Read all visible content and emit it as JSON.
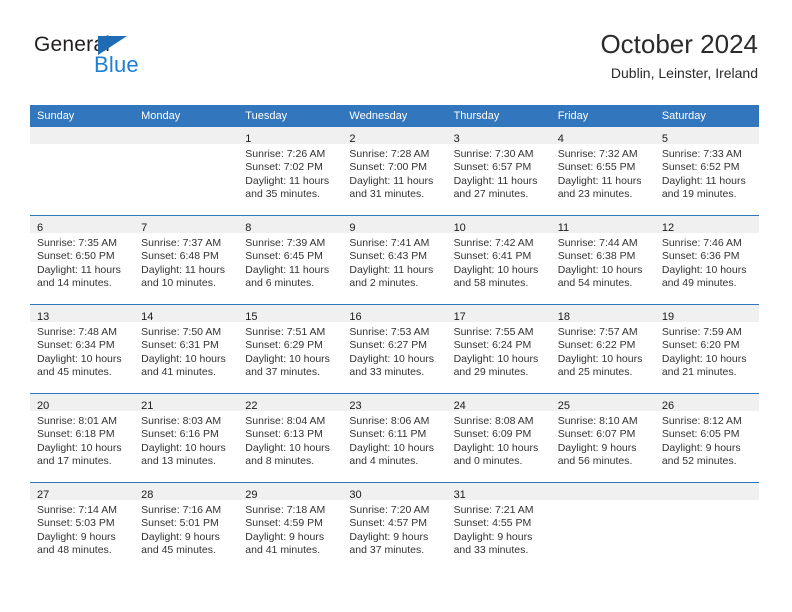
{
  "brand": {
    "name_dark": "General",
    "name_blue": "Blue",
    "accent_color": "#1f7fd4",
    "triangle_color": "#1f6cb4"
  },
  "header": {
    "month_title": "October 2024",
    "location": "Dublin, Leinster, Ireland"
  },
  "theme": {
    "header_row_bg": "#3276bd",
    "header_row_text": "#ffffff",
    "daynum_strip_bg": "#f0f0f0",
    "row_divider": "#3276bd"
  },
  "weekday_headers": [
    "Sunday",
    "Monday",
    "Tuesday",
    "Wednesday",
    "Thursday",
    "Friday",
    "Saturday"
  ],
  "labels": {
    "sunrise_prefix": "Sunrise:",
    "sunset_prefix": "Sunset:",
    "daylight_prefix": "Daylight:"
  },
  "weeks": [
    [
      {
        "empty": true
      },
      {
        "empty": true
      },
      {
        "day": "1",
        "sunrise": "Sunrise: 7:26 AM",
        "sunset": "Sunset: 7:02 PM",
        "daylight": "Daylight: 11 hours and 35 minutes."
      },
      {
        "day": "2",
        "sunrise": "Sunrise: 7:28 AM",
        "sunset": "Sunset: 7:00 PM",
        "daylight": "Daylight: 11 hours and 31 minutes."
      },
      {
        "day": "3",
        "sunrise": "Sunrise: 7:30 AM",
        "sunset": "Sunset: 6:57 PM",
        "daylight": "Daylight: 11 hours and 27 minutes."
      },
      {
        "day": "4",
        "sunrise": "Sunrise: 7:32 AM",
        "sunset": "Sunset: 6:55 PM",
        "daylight": "Daylight: 11 hours and 23 minutes."
      },
      {
        "day": "5",
        "sunrise": "Sunrise: 7:33 AM",
        "sunset": "Sunset: 6:52 PM",
        "daylight": "Daylight: 11 hours and 19 minutes."
      }
    ],
    [
      {
        "day": "6",
        "sunrise": "Sunrise: 7:35 AM",
        "sunset": "Sunset: 6:50 PM",
        "daylight": "Daylight: 11 hours and 14 minutes."
      },
      {
        "day": "7",
        "sunrise": "Sunrise: 7:37 AM",
        "sunset": "Sunset: 6:48 PM",
        "daylight": "Daylight: 11 hours and 10 minutes."
      },
      {
        "day": "8",
        "sunrise": "Sunrise: 7:39 AM",
        "sunset": "Sunset: 6:45 PM",
        "daylight": "Daylight: 11 hours and 6 minutes."
      },
      {
        "day": "9",
        "sunrise": "Sunrise: 7:41 AM",
        "sunset": "Sunset: 6:43 PM",
        "daylight": "Daylight: 11 hours and 2 minutes."
      },
      {
        "day": "10",
        "sunrise": "Sunrise: 7:42 AM",
        "sunset": "Sunset: 6:41 PM",
        "daylight": "Daylight: 10 hours and 58 minutes."
      },
      {
        "day": "11",
        "sunrise": "Sunrise: 7:44 AM",
        "sunset": "Sunset: 6:38 PM",
        "daylight": "Daylight: 10 hours and 54 minutes."
      },
      {
        "day": "12",
        "sunrise": "Sunrise: 7:46 AM",
        "sunset": "Sunset: 6:36 PM",
        "daylight": "Daylight: 10 hours and 49 minutes."
      }
    ],
    [
      {
        "day": "13",
        "sunrise": "Sunrise: 7:48 AM",
        "sunset": "Sunset: 6:34 PM",
        "daylight": "Daylight: 10 hours and 45 minutes."
      },
      {
        "day": "14",
        "sunrise": "Sunrise: 7:50 AM",
        "sunset": "Sunset: 6:31 PM",
        "daylight": "Daylight: 10 hours and 41 minutes."
      },
      {
        "day": "15",
        "sunrise": "Sunrise: 7:51 AM",
        "sunset": "Sunset: 6:29 PM",
        "daylight": "Daylight: 10 hours and 37 minutes."
      },
      {
        "day": "16",
        "sunrise": "Sunrise: 7:53 AM",
        "sunset": "Sunset: 6:27 PM",
        "daylight": "Daylight: 10 hours and 33 minutes."
      },
      {
        "day": "17",
        "sunrise": "Sunrise: 7:55 AM",
        "sunset": "Sunset: 6:24 PM",
        "daylight": "Daylight: 10 hours and 29 minutes."
      },
      {
        "day": "18",
        "sunrise": "Sunrise: 7:57 AM",
        "sunset": "Sunset: 6:22 PM",
        "daylight": "Daylight: 10 hours and 25 minutes."
      },
      {
        "day": "19",
        "sunrise": "Sunrise: 7:59 AM",
        "sunset": "Sunset: 6:20 PM",
        "daylight": "Daylight: 10 hours and 21 minutes."
      }
    ],
    [
      {
        "day": "20",
        "sunrise": "Sunrise: 8:01 AM",
        "sunset": "Sunset: 6:18 PM",
        "daylight": "Daylight: 10 hours and 17 minutes."
      },
      {
        "day": "21",
        "sunrise": "Sunrise: 8:03 AM",
        "sunset": "Sunset: 6:16 PM",
        "daylight": "Daylight: 10 hours and 13 minutes."
      },
      {
        "day": "22",
        "sunrise": "Sunrise: 8:04 AM",
        "sunset": "Sunset: 6:13 PM",
        "daylight": "Daylight: 10 hours and 8 minutes."
      },
      {
        "day": "23",
        "sunrise": "Sunrise: 8:06 AM",
        "sunset": "Sunset: 6:11 PM",
        "daylight": "Daylight: 10 hours and 4 minutes."
      },
      {
        "day": "24",
        "sunrise": "Sunrise: 8:08 AM",
        "sunset": "Sunset: 6:09 PM",
        "daylight": "Daylight: 10 hours and 0 minutes."
      },
      {
        "day": "25",
        "sunrise": "Sunrise: 8:10 AM",
        "sunset": "Sunset: 6:07 PM",
        "daylight": "Daylight: 9 hours and 56 minutes."
      },
      {
        "day": "26",
        "sunrise": "Sunrise: 8:12 AM",
        "sunset": "Sunset: 6:05 PM",
        "daylight": "Daylight: 9 hours and 52 minutes."
      }
    ],
    [
      {
        "day": "27",
        "sunrise": "Sunrise: 7:14 AM",
        "sunset": "Sunset: 5:03 PM",
        "daylight": "Daylight: 9 hours and 48 minutes."
      },
      {
        "day": "28",
        "sunrise": "Sunrise: 7:16 AM",
        "sunset": "Sunset: 5:01 PM",
        "daylight": "Daylight: 9 hours and 45 minutes."
      },
      {
        "day": "29",
        "sunrise": "Sunrise: 7:18 AM",
        "sunset": "Sunset: 4:59 PM",
        "daylight": "Daylight: 9 hours and 41 minutes."
      },
      {
        "day": "30",
        "sunrise": "Sunrise: 7:20 AM",
        "sunset": "Sunset: 4:57 PM",
        "daylight": "Daylight: 9 hours and 37 minutes."
      },
      {
        "day": "31",
        "sunrise": "Sunrise: 7:21 AM",
        "sunset": "Sunset: 4:55 PM",
        "daylight": "Daylight: 9 hours and 33 minutes."
      },
      {
        "empty": true
      },
      {
        "empty": true
      }
    ]
  ]
}
